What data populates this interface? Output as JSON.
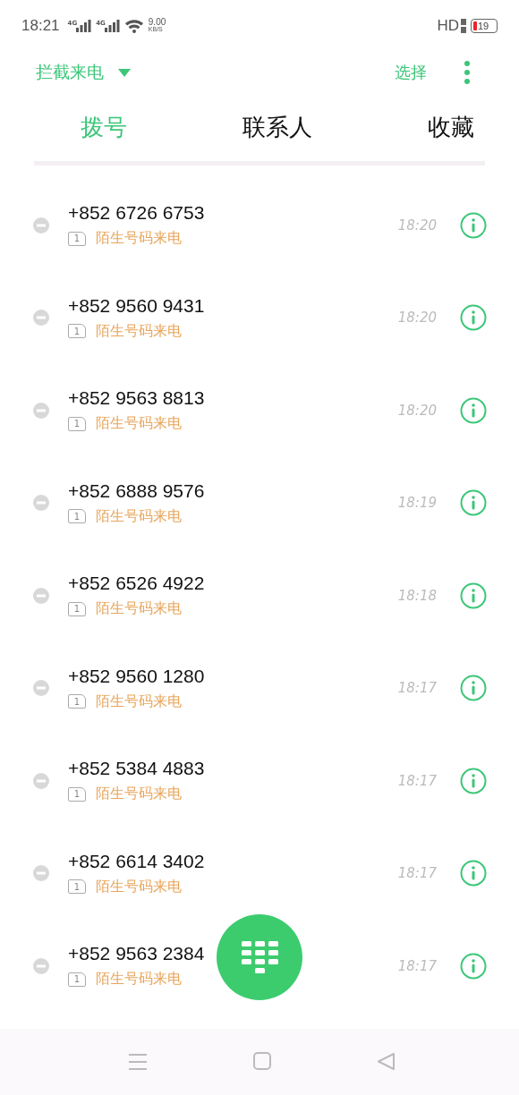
{
  "status_bar": {
    "time": "18:21",
    "signals": [
      "4G",
      "4G"
    ],
    "speed": "9.00",
    "speed_unit": "KB/S",
    "hd": "HD",
    "battery": "19"
  },
  "header": {
    "filter": "拦截来电",
    "select": "选择"
  },
  "tabs": [
    {
      "label": "拨号",
      "selected": true
    },
    {
      "label": "联系人",
      "selected": false
    },
    {
      "label": "收藏",
      "selected": false
    }
  ],
  "calls": [
    {
      "number": "+852 6726 6753",
      "sim": "1",
      "label": "陌生号码来电",
      "time": "18:20"
    },
    {
      "number": "+852 9560 9431",
      "sim": "1",
      "label": "陌生号码来电",
      "time": "18:20"
    },
    {
      "number": "+852 9563 8813",
      "sim": "1",
      "label": "陌生号码来电",
      "time": "18:20"
    },
    {
      "number": "+852 6888 9576",
      "sim": "1",
      "label": "陌生号码来电",
      "time": "18:19"
    },
    {
      "number": "+852 6526 4922",
      "sim": "1",
      "label": "陌生号码来电",
      "time": "18:18"
    },
    {
      "number": "+852 9560 1280",
      "sim": "1",
      "label": "陌生号码来电",
      "time": "18:17"
    },
    {
      "number": "+852 5384 4883",
      "sim": "1",
      "label": "陌生号码来电",
      "time": "18:17"
    },
    {
      "number": "+852 6614 3402",
      "sim": "1",
      "label": "陌生号码来电",
      "time": "18:17"
    },
    {
      "number": "+852 9563 2384",
      "sim": "1",
      "label": "陌生号码来电",
      "time": "18:17"
    }
  ]
}
